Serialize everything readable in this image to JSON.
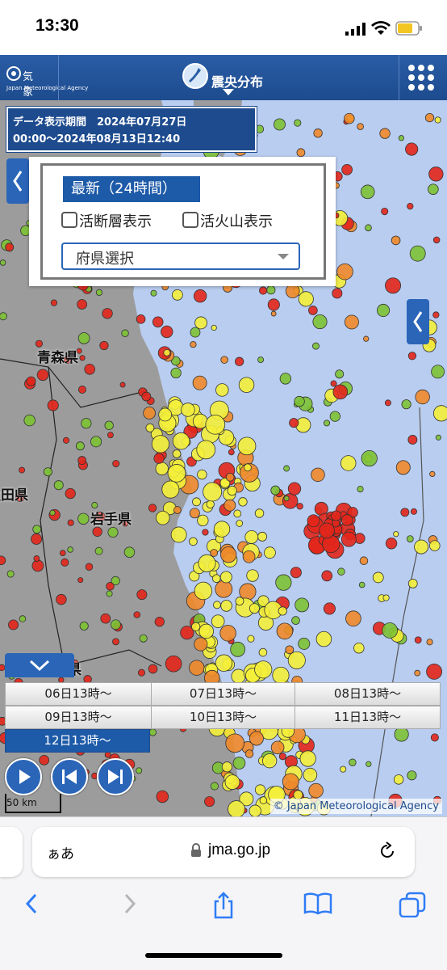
{
  "status_bar": {
    "time": "13:30"
  },
  "app_bar": {
    "logo_jp": "気象庁",
    "logo_en": "Japan Meteorological Agency",
    "title": "震央分布"
  },
  "period": {
    "line1": "データ表示期間　2024年07月27日",
    "line2": "00:00～2024年08月13日12:40"
  },
  "panel": {
    "latest_label": "最新（24時間）",
    "fault_checkbox": "活断層表示",
    "volcano_checkbox": "活火山表示",
    "prefecture_select": "府県選択"
  },
  "map_labels": {
    "aomori": "青森県",
    "akita": "秋田県",
    "iwate": "岩手県",
    "miyagi": "宮城県"
  },
  "time_tabs": [
    {
      "label": "06日13時～",
      "selected": false
    },
    {
      "label": "07日13時～",
      "selected": false
    },
    {
      "label": "08日13時～",
      "selected": false
    },
    {
      "label": "09日13時～",
      "selected": false
    },
    {
      "label": "10日13時～",
      "selected": false
    },
    {
      "label": "11日13時～",
      "selected": false
    },
    {
      "label": "12日13時～",
      "selected": true
    }
  ],
  "scale": "50 km",
  "copyright": "© Japan Meteorological Agency",
  "browser": {
    "aa": "ぁあ",
    "domain": "jma.go.jp"
  },
  "colors": {
    "accent": "#1d5aa8",
    "sea": "#b9cdf0",
    "quake_red": "#e3261b",
    "quake_orange": "#f08a2a",
    "quake_yellow": "#f4f03a",
    "quake_green": "#7dc234"
  }
}
